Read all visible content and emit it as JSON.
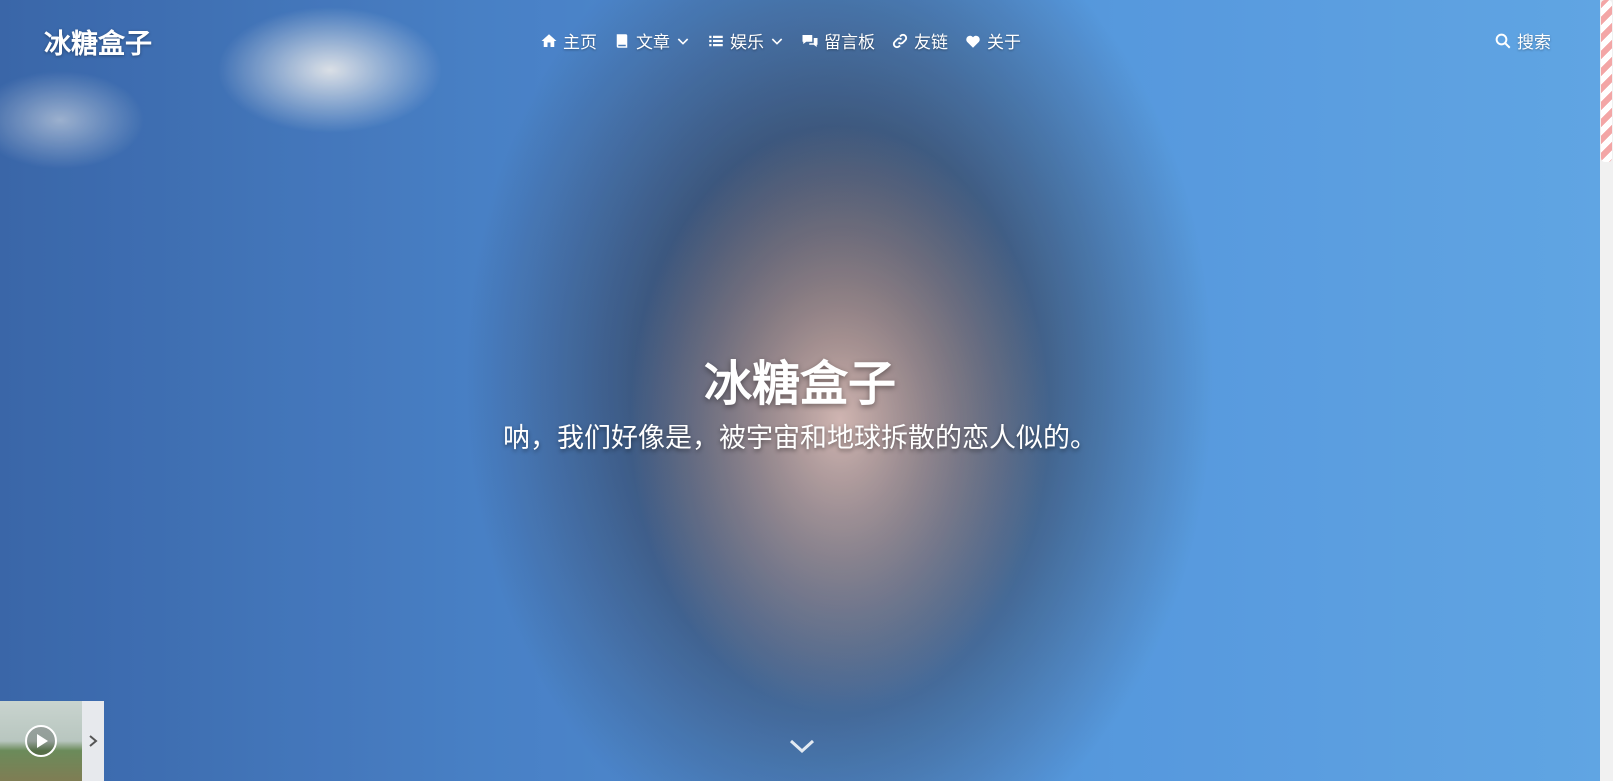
{
  "site": {
    "brand": "冰糖盒子"
  },
  "nav": {
    "items": [
      {
        "label": "主页",
        "icon": "home-icon"
      },
      {
        "label": "文章",
        "icon": "book-icon",
        "dropdown": true
      },
      {
        "label": "娱乐",
        "icon": "list-icon",
        "dropdown": true
      },
      {
        "label": "留言板",
        "icon": "comments-icon"
      },
      {
        "label": "友链",
        "icon": "link-icon"
      },
      {
        "label": "关于",
        "icon": "heart-icon"
      }
    ],
    "search_label": "搜索"
  },
  "hero": {
    "title": "冰糖盒子",
    "subtitle": "呐，我们好像是，被宇宙和地球拆散的恋人似的。"
  },
  "colors": {
    "accent": "#5ea6f0",
    "scrollbar_thumb": "#f3a6a6"
  }
}
